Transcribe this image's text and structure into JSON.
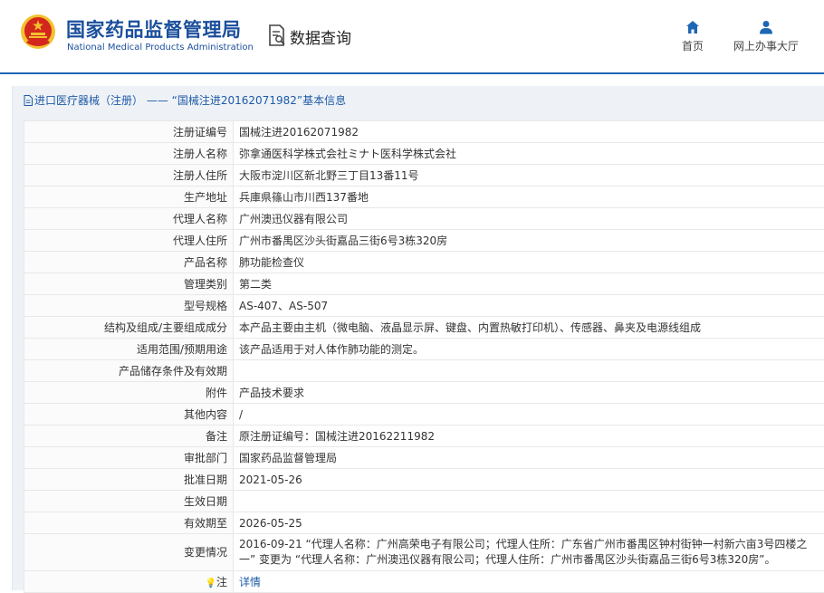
{
  "header": {
    "logo_cn": "国家药品监督管理局",
    "logo_en": "National Medical Products Administration",
    "query_title": "数据查询",
    "nav": [
      {
        "icon": "home-icon",
        "label": "首页"
      },
      {
        "icon": "user-icon",
        "label": "网上办事大厅"
      }
    ]
  },
  "breadcrumb": {
    "link": "进口医疗器械（注册）",
    "sep": " —— ",
    "title": "“国械注进20162071982”基本信息"
  },
  "rows": [
    {
      "label": "注册证编号",
      "value": "国械注进20162071982"
    },
    {
      "label": "注册人名称",
      "value": "弥拿通医科学株式会社ミナト医科学株式会社"
    },
    {
      "label": "注册人住所",
      "value": "大阪市淀川区新北野三丁目13番11号"
    },
    {
      "label": "生产地址",
      "value": "兵庫県篠山市川西137番地"
    },
    {
      "label": "代理人名称",
      "value": "广州澳迅仪器有限公司"
    },
    {
      "label": "代理人住所",
      "value": "广州市番禺区沙头街嘉品三街6号3栋320房"
    },
    {
      "label": "产品名称",
      "value": "肺功能检查仪"
    },
    {
      "label": "管理类别",
      "value": "第二类"
    },
    {
      "label": "型号规格",
      "value": "AS-407、AS-507"
    },
    {
      "label": "结构及组成/主要组成成分",
      "value": "本产品主要由主机（微电脑、液晶显示屏、键盘、内置热敏打印机）、传感器、鼻夹及电源线组成"
    },
    {
      "label": "适用范围/预期用途",
      "value": "该产品适用于对人体作肺功能的测定。"
    },
    {
      "label": "产品储存条件及有效期",
      "value": ""
    },
    {
      "label": "附件",
      "value": "产品技术要求"
    },
    {
      "label": "其他内容",
      "value": "/"
    },
    {
      "label": "备注",
      "value": "原注册证编号：国械注进20162211982"
    },
    {
      "label": "审批部门",
      "value": "国家药品监督管理局"
    },
    {
      "label": "批准日期",
      "value": "2021-05-26"
    },
    {
      "label": "生效日期",
      "value": ""
    },
    {
      "label": "有效期至",
      "value": "2026-05-25"
    },
    {
      "label": "变更情况",
      "value": "2016-09-21 “代理人名称：广州高荣电子有限公司；代理人住所：广东省广州市番禺区钟村街钟一村新六亩3号四楼之一” 变更为 “代理人名称：广州澳迅仪器有限公司；代理人住所：广州市番禺区沙头街嘉品三街6号3栋320房”。"
    }
  ],
  "note": {
    "icon": "lightbulb-icon",
    "label": "注",
    "link": "详情"
  },
  "colors": {
    "brand_blue": "#1b4f9c",
    "header_rule": "#1e66b5",
    "panel_bg": "#eef2f6",
    "emblem_red": "#d3261c",
    "emblem_gold": "#f2c12e"
  }
}
